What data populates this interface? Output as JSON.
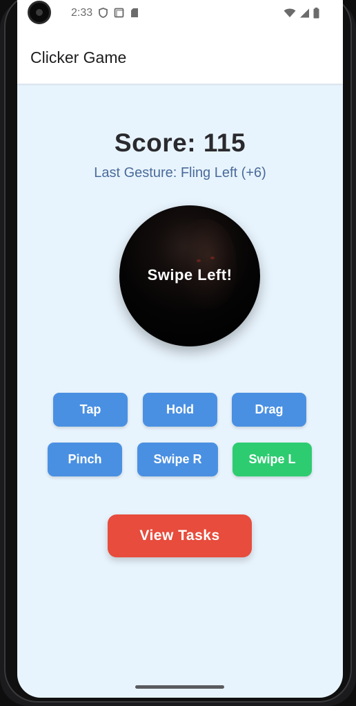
{
  "status_bar": {
    "time": "2:33",
    "left_icons": [
      "shield-icon",
      "square-icon",
      "sd-card-icon"
    ],
    "right_icons": [
      "wifi-icon",
      "cell-signal-icon",
      "battery-icon"
    ]
  },
  "app_bar": {
    "title": "Clicker Game"
  },
  "game": {
    "score_text": "Score: 115",
    "last_gesture_text": "Last Gesture: Fling Left (+6)",
    "target_label": "Swipe Left!"
  },
  "gesture_buttons": [
    {
      "label": "Tap",
      "active": false
    },
    {
      "label": "Hold",
      "active": false
    },
    {
      "label": "Drag",
      "active": false
    },
    {
      "label": "Pinch",
      "active": false
    },
    {
      "label": "Swipe R",
      "active": false
    },
    {
      "label": "Swipe L",
      "active": true
    }
  ],
  "actions": {
    "view_tasks_label": "View Tasks"
  },
  "colors": {
    "background": "#e8f4fd",
    "gesture_button": "#4a90e2",
    "gesture_button_active": "#2ecc71",
    "view_tasks_button": "#e74c3c",
    "last_gesture_text": "#4a6a9a"
  }
}
